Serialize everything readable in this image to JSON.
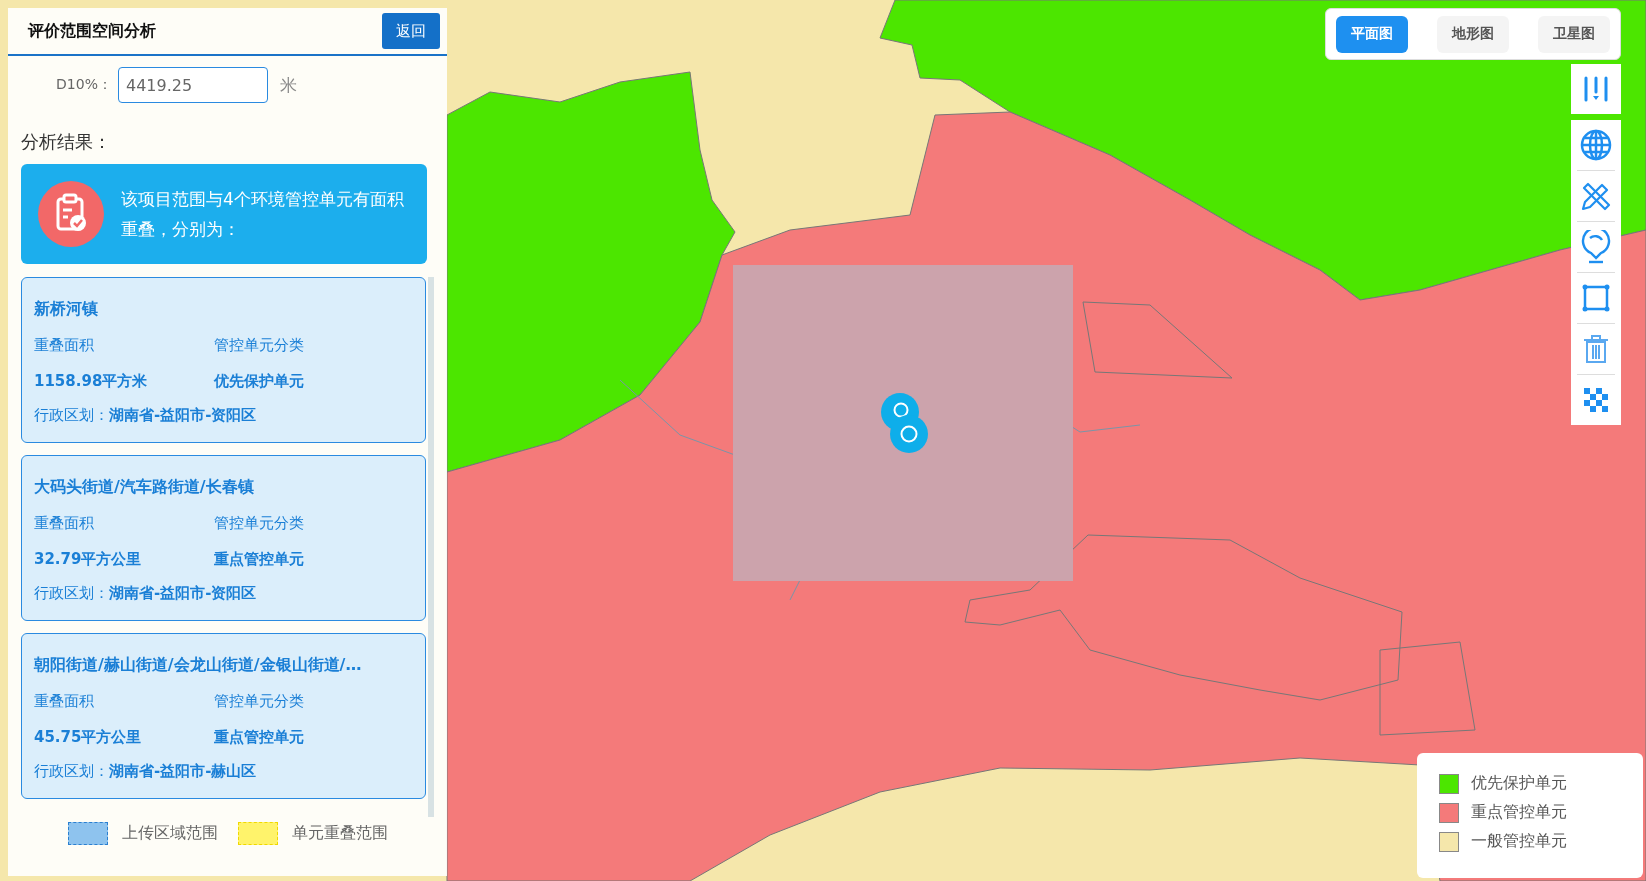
{
  "panel": {
    "title": "评价范围空间分析",
    "back_button": "返回",
    "d10_label": "D10%：",
    "d10_value": "4419.25",
    "d10_unit": "米",
    "results_label": "分析结果：",
    "summary": "该项目范围与4个环境管控单元有面积重叠，分别为：",
    "results": [
      {
        "name": "新桥河镇",
        "area_label": "重叠面积",
        "area": "1158.98平方米",
        "category_label": "管控单元分类",
        "category": "优先保护单元",
        "region_label": "行政区划：",
        "region": "湖南省-益阳市-资阳区"
      },
      {
        "name": "大码头街道/汽车路街道/长春镇",
        "area_label": "重叠面积",
        "area": "32.79平方公里",
        "category_label": "管控单元分类",
        "category": "重点管控单元",
        "region_label": "行政区划：",
        "region": "湖南省-益阳市-资阳区"
      },
      {
        "name": "朝阳街道/赫山街道/会龙山街道/金银山街道/…",
        "area_label": "重叠面积",
        "area": "45.75平方公里",
        "category_label": "管控单元分类",
        "category": "重点管控单元",
        "region_label": "行政区划：",
        "region": "湖南省-益阳市-赫山区"
      }
    ],
    "legend": [
      {
        "label": "上传区域范围",
        "kind": "upload"
      },
      {
        "label": "单元重叠范围",
        "kind": "overlap"
      }
    ]
  },
  "map_types": [
    {
      "label": "平面图",
      "selected": true
    },
    {
      "label": "地形图",
      "selected": false
    },
    {
      "label": "卫星图",
      "selected": false
    }
  ],
  "map_legend": [
    {
      "label": "优先保护单元",
      "color": "#4ce600"
    },
    {
      "label": "重点管控单元",
      "color": "#f47a7a"
    },
    {
      "label": "一般管控单元",
      "color": "#f5e7ab"
    }
  ]
}
